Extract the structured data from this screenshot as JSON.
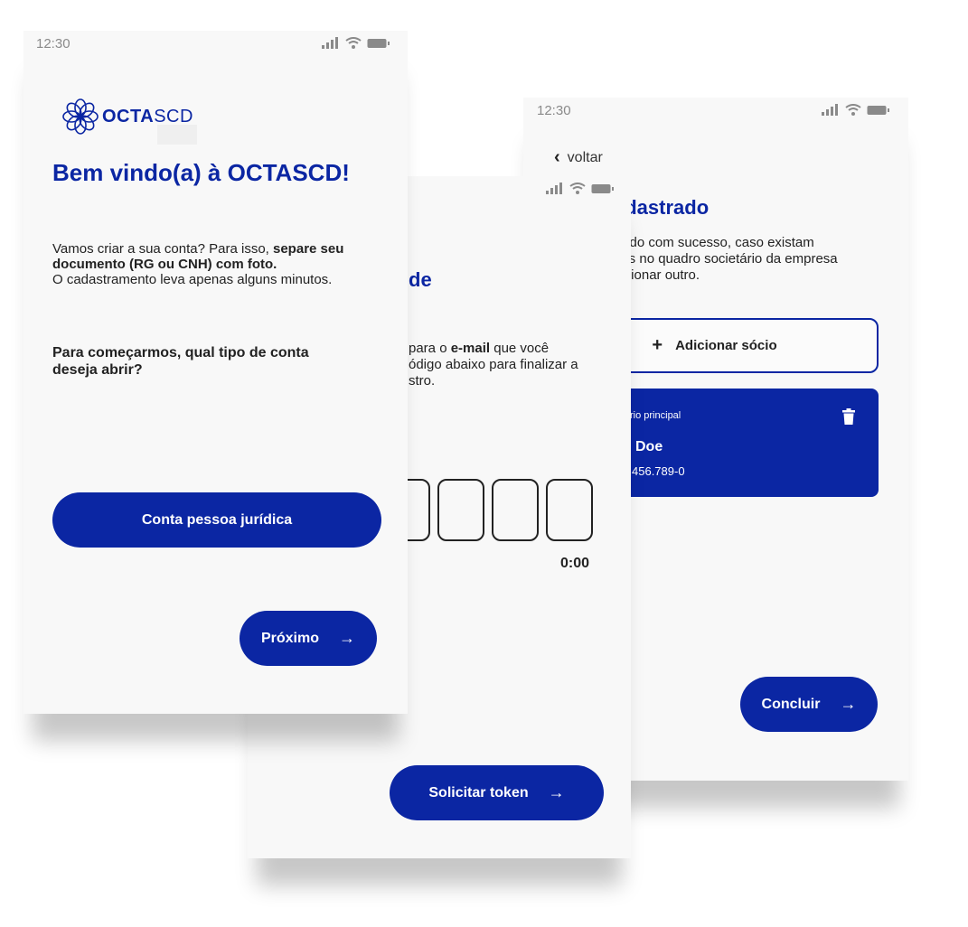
{
  "colors": {
    "brand": "#0b26a3",
    "background": "#f8f8f8",
    "text": "#222222"
  },
  "status_bar": {
    "time": "12:30",
    "icons": [
      "signal-icon",
      "wifi-icon",
      "battery-icon"
    ]
  },
  "screen_welcome": {
    "logo": {
      "bold": "OCTA",
      "light": "SCD"
    },
    "title": "Bem vindo(a) à OCTASCD!",
    "intro_plain": "Vamos criar a sua conta? Para isso, ",
    "intro_bold": "separe seu documento (RG ou CNH) com foto.",
    "intro_line2": "O cadastramento leva apenas alguns minutos.",
    "question": "Para começarmos, qual tipo de conta deseja abrir?",
    "account_button": "Conta pessoa jurídica",
    "next_button": "Próximo"
  },
  "screen_token": {
    "title_fragment": "de",
    "text_line1_plain": "para o ",
    "text_line1_bold": "e-mail",
    "text_line1_rest": " que você",
    "text_line2": "ódigo abaixo para finalizar a",
    "text_line3": "stro.",
    "timer": "0:00",
    "token_button": "Solicitar token"
  },
  "screen_partners": {
    "back_label": "voltar",
    "title_fragment": "adastrado",
    "text_line1": "trado com sucesso, caso existam",
    "text_line2": "bas no quadro societário da empresa",
    "text_line3": "dicionar outro.",
    "add_button": "Adicionar sócio",
    "card_label": "rio principal",
    "card_name": "Doe",
    "card_doc": "456.789-0",
    "done_button": "Concluir"
  },
  "icons": {
    "arrow": "→",
    "chevron": "‹",
    "plus": "+",
    "trash": "trash-icon"
  }
}
